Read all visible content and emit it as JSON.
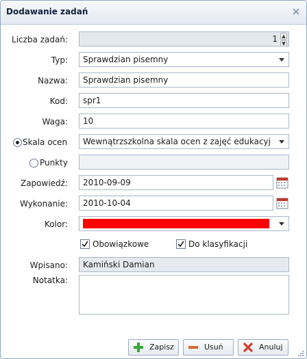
{
  "dialog": {
    "title": "Dodawanie zadań"
  },
  "fields": {
    "count": {
      "label": "Liczba zadań:",
      "value": "1"
    },
    "type": {
      "label": "Typ:",
      "value": "Sprawdzian pisemny"
    },
    "name": {
      "label": "Nazwa:",
      "value": "Sprawdzian pisemny"
    },
    "code": {
      "label": "Kod:",
      "value": "spr1"
    },
    "weight": {
      "label": "Waga:",
      "value": "10"
    },
    "scale": {
      "label": "Skala ocen",
      "value": "Wewnątrzszkolna skala ocen z zajęć edukacyj",
      "selected": true
    },
    "points": {
      "label": "Punkty",
      "value": "",
      "selected": false
    },
    "announced": {
      "label": "Zapowiedź:",
      "value": "2010-09-09"
    },
    "executed": {
      "label": "Wykonanie:",
      "value": "2010-10-04"
    },
    "color": {
      "label": "Kolor:",
      "value": "#ff0000"
    },
    "mandatory": {
      "label": "Obowiązkowe",
      "checked": true
    },
    "classification": {
      "label": "Do klasyfikacji",
      "checked": true
    },
    "entered_by": {
      "label": "Wpisano:",
      "value": "Kamiński Damian"
    },
    "note": {
      "label": "Notatka:",
      "value": ""
    }
  },
  "buttons": {
    "save": "Zapisz",
    "delete": "Usuń",
    "cancel": "Anuluj"
  },
  "icons": {
    "close": "close-icon",
    "calendar": "calendar-icon",
    "save": "plus-icon",
    "delete": "minus-icon",
    "cancel": "x-icon"
  }
}
